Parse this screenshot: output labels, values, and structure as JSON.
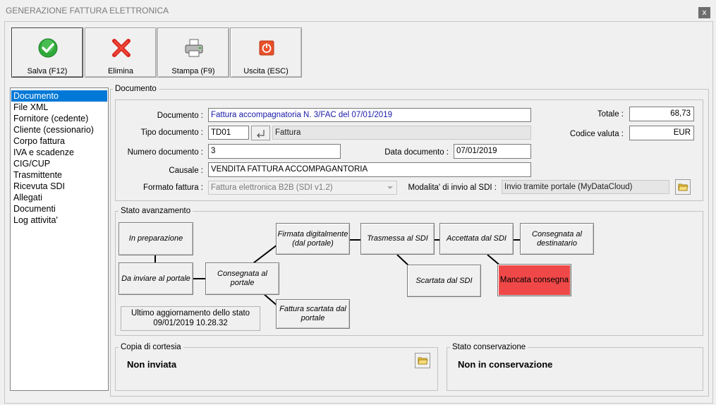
{
  "window": {
    "title": "GENERAZIONE FATTURA ELETTRONICA",
    "close_glyph": "x"
  },
  "toolbar": {
    "save_label": "Salva (F12)",
    "delete_label": "Elimina",
    "print_label": "Stampa (F9)",
    "exit_label": "Uscita (ESC)"
  },
  "sidebar": {
    "items": [
      {
        "label": "Documento",
        "selected": true
      },
      {
        "label": "File XML"
      },
      {
        "label": "Fornitore (cedente)"
      },
      {
        "label": "Cliente (cessionario)"
      },
      {
        "label": "Corpo fattura"
      },
      {
        "label": "IVA e scadenze"
      },
      {
        "label": "CIG/CUP"
      },
      {
        "label": "Trasmittente"
      },
      {
        "label": "Ricevuta SDI"
      },
      {
        "label": "Allegati"
      },
      {
        "label": "Documenti"
      },
      {
        "label": "Log attivita'"
      }
    ]
  },
  "document": {
    "group_title": "Documento",
    "documento_label": "Documento :",
    "documento_value": "Fattura accompagnatoria N. 3/FAC del 07/01/2019",
    "tipo_label": "Tipo documento :",
    "tipo_code": "TD01",
    "tipo_desc": "Fattura",
    "numero_label": "Numero documento :",
    "numero_value": "3",
    "data_label": "Data documento :",
    "data_value": "07/01/2019",
    "causale_label": "Causale :",
    "causale_value": "VENDITA FATTURA ACCOMPAGANTORIA",
    "formato_label": "Formato fattura :",
    "formato_value": "Fattura elettronica B2B (SDI v1.2)",
    "totale_label": "Totale :",
    "totale_value": "68,73",
    "valuta_label": "Codice valuta :",
    "valuta_value": "EUR",
    "modalita_label": "Modalita' di invio al SDI :",
    "modalita_value": "Invio tramite portale (MyDataCloud)"
  },
  "status": {
    "group_title": "Stato avanzamento",
    "in_preparazione": "In preparazione",
    "da_inviare": "Da inviare al portale",
    "consegnata_portale": "Consegnata al portale",
    "firmata": "Firmata digitalmente (dal portale)",
    "scartata_portale": "Fattura scartata dal portale",
    "trasmessa": "Trasmessa al SDI",
    "scartata_sdi": "Scartata dal SDI",
    "accettata": "Accettata dal SDI",
    "consegnata_dest": "Consegnata al destinatario",
    "mancata": "Mancata consegna",
    "last_update_label": "Ultimo aggiornamento dello stato",
    "last_update_value": "09/01/2019 10.28.32",
    "highlight_color": "#f04848"
  },
  "copia": {
    "group_title": "Copia di cortesia",
    "value": "Non inviata"
  },
  "conservazione": {
    "group_title": "Stato conservazione",
    "value": "Non in conservazione"
  }
}
